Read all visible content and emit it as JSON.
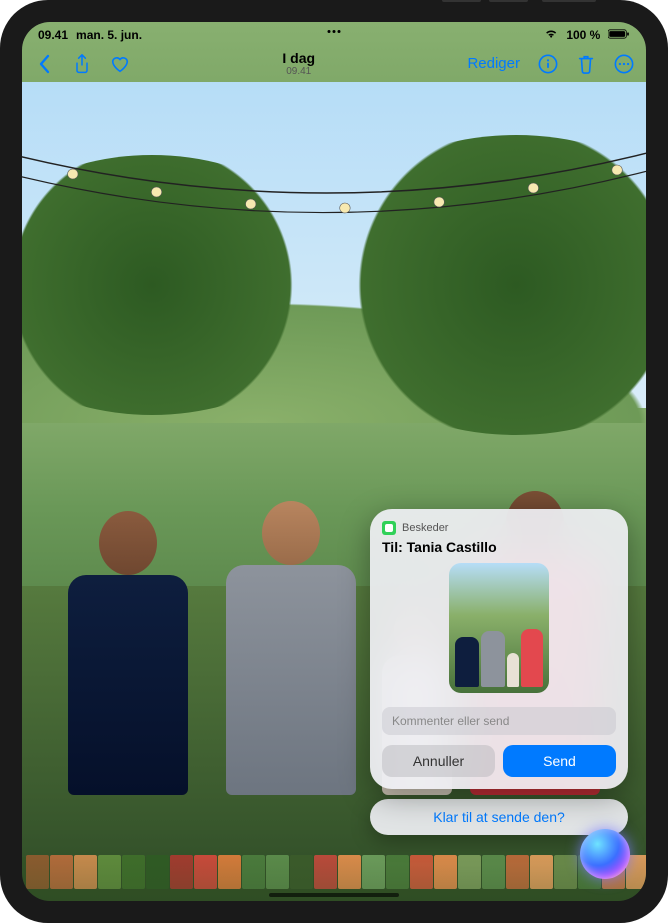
{
  "status": {
    "time": "09.41",
    "date": "man. 5. jun.",
    "battery_pct": "100 %"
  },
  "nav": {
    "title": "I dag",
    "subtitle": "09.41",
    "edit_label": "Rediger"
  },
  "siri": {
    "app_name": "Beskeder",
    "to_prefix": "Til:",
    "to_name": "Tania Castillo",
    "comment_placeholder": "Kommenter eller send",
    "cancel_label": "Annuller",
    "send_label": "Send",
    "followup": "Klar til at sende den?"
  },
  "thumb_colors": [
    "#8a5b2e",
    "#b06a3a",
    "#c5894c",
    "#5e8a3c",
    "#3e6d2a",
    "#2f5a24",
    "#a03b2e",
    "#c74a3a",
    "#d27a3a",
    "#4a7a3c",
    "#5a8a4a",
    "#3a5a2a",
    "#b84a3a",
    "#d88a4a",
    "#6a9a5a",
    "#4a7a3a",
    "#c75a3a",
    "#da8a4a",
    "#7a9a5a",
    "#5a8a4a",
    "#b86a3a",
    "#d89a5a",
    "#6a8a4a",
    "#4a7a3a",
    "#c77a4a",
    "#da9a5a"
  ]
}
